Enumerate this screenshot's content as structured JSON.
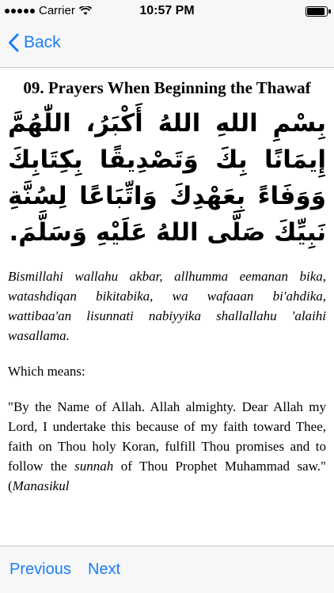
{
  "status_bar": {
    "carrier": "Carrier",
    "time": "10:57 PM"
  },
  "nav": {
    "back_label": "Back"
  },
  "content": {
    "title": "09. Prayers When Beginning the Thawaf",
    "arabic": "بِسْمِ اللهِ اللهُ أَكْبَرُ، اللّٰهُمَّ إِيمَانًا بِكَ وَتَصْدِيقًا بِكِتَابِكَ وَوَفَاءً بِعَهْدِكَ وَاتِّبَاعًا لِسُنَّةِ نَبِيِّكَ صَلَّى اللهُ عَلَيْهِ وَسَلَّمَ.",
    "transliteration": "Bismillahi wallahu akbar, allhumma eemanan bika, watashdiqan bikitabika, wa wafaaan bi'ahdika, wattibaa'an lisunnati nabiyyika shallallahu 'alaihi wasallama.",
    "which_means": "Which means:",
    "meaning_1": "\"By the Name of Allah. Allah almighty. Dear Allah my Lord, I undertake this because of my faith toward Thee, faith on Thou holy Koran, fulfill Thou promises and to follow the ",
    "meaning_sunnah": "sunnah",
    "meaning_2": " of Thou Prophet Muhammad saw.\"(",
    "meaning_source": "Manasikul"
  },
  "toolbar": {
    "previous_label": "Previous",
    "next_label": "Next"
  },
  "colors": {
    "accent": "#1a7ef5",
    "bar_bg": "#f7f7f7"
  },
  "icons": {
    "back": "chevron-left-icon",
    "signal": "signal-icon",
    "wifi": "wifi-icon",
    "battery": "battery-icon"
  }
}
